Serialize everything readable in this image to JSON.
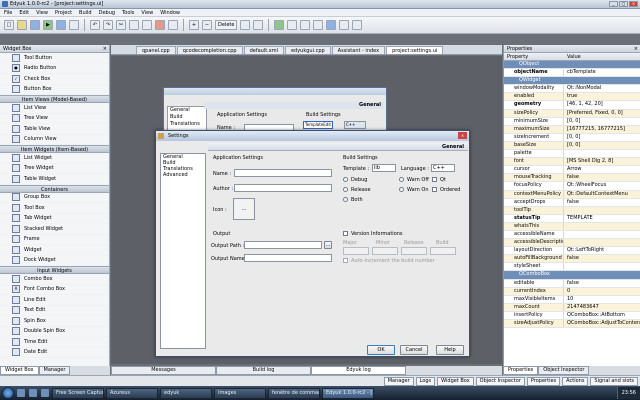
{
  "window": {
    "title": "Edyuk 1.0.0-rc2 - [project:settings.ui]"
  },
  "menu": [
    "File",
    "Edit",
    "View",
    "Project",
    "Build",
    "Debug",
    "Tools",
    "View",
    "Window"
  ],
  "toolbar": {
    "delete_label": "Delete"
  },
  "left_panel": {
    "title": "Widget Box",
    "groups": [
      {
        "items": [
          {
            "label": "Tool Button",
            "icon": "tool-button-icon"
          },
          {
            "label": "Radio Button",
            "icon": "radio-button-icon"
          },
          {
            "label": "Check Box",
            "icon": "check-box-icon"
          },
          {
            "label": "Button Box",
            "icon": "button-box-icon"
          }
        ]
      },
      {
        "title": "Item Views (Model-Based)",
        "items": [
          {
            "label": "List View"
          },
          {
            "label": "Tree View"
          },
          {
            "label": "Table View"
          },
          {
            "label": "Column View"
          }
        ]
      },
      {
        "title": "Item Widgets (Item-Based)",
        "items": [
          {
            "label": "List Widget"
          },
          {
            "label": "Tree Widget"
          },
          {
            "label": "Table Widget"
          }
        ]
      },
      {
        "title": "Containers",
        "items": [
          {
            "label": "Group Box"
          },
          {
            "label": "Tool Box"
          },
          {
            "label": "Tab Widget"
          },
          {
            "label": "Stacked Widget"
          },
          {
            "label": "Frame"
          },
          {
            "label": "Widget"
          },
          {
            "label": "Dock Widget"
          }
        ]
      },
      {
        "title": "Input Widgets",
        "items": [
          {
            "label": "Combo Box"
          },
          {
            "label": "Font Combo Box"
          },
          {
            "label": "Line Edit"
          },
          {
            "label": "Text Edit"
          },
          {
            "label": "Spin Box"
          },
          {
            "label": "Double Spin Box"
          },
          {
            "label": "Time Edit"
          },
          {
            "label": "Date Edit"
          }
        ]
      }
    ],
    "tabs": [
      "Widget Box",
      "Manager"
    ]
  },
  "doc_tabs": [
    "qpanel.cpp",
    "qcodecompletion.cpp",
    "default.xml",
    "edyukgui.cpp",
    "Assistant - index",
    "project:settings.ui"
  ],
  "bg_form": {
    "items": [
      "General",
      "Build",
      "Translations"
    ],
    "general": "General",
    "app_settings": "Application Settings",
    "name_label": "Name :",
    "build_settings": "Build Settings",
    "template_value": "TemplateEdit",
    "language_value": "C++"
  },
  "dialog": {
    "title": "Settings",
    "header": "General",
    "list": [
      "General",
      "Build",
      "Translations",
      "Advanced"
    ],
    "app_settings": "Application Settings",
    "name_label": "Name :",
    "author_label": "Author :",
    "icon_label": "Icon :",
    "icon_btn": "...",
    "output": "Output",
    "output_path": "Output Path :",
    "output_name": "Output Name :",
    "browse": "...",
    "build_settings": "Build Settings",
    "template_label": "Template :",
    "template_value": "lib",
    "language_label": "Language :",
    "language_value": "C++",
    "modes": [
      "Debug",
      "Release",
      "Both"
    ],
    "warn": [
      "Warn Off",
      "Warn On"
    ],
    "opts": [
      "Qt",
      "Ordered"
    ],
    "version_label": "Version Informations",
    "version_fields": [
      "Major",
      "Minor",
      "Release",
      "Build"
    ],
    "auto_inc": "Auto-increment the build number",
    "ok": "OK",
    "cancel": "Cancel",
    "help": "Help"
  },
  "properties": {
    "title": "Properties",
    "cols": [
      "Property",
      "Value"
    ],
    "rows": [
      {
        "s": "QObject"
      },
      {
        "k": "objectName",
        "v": "cbTemplate",
        "b": true
      },
      {
        "s": "QWidget"
      },
      {
        "k": "windowModality",
        "v": "Qt::NonModal"
      },
      {
        "k": "enabled",
        "v": "true"
      },
      {
        "k": "geometry",
        "v": "[46, 1, 42, 20]",
        "b": true
      },
      {
        "k": "sizePolicy",
        "v": "[Preferred, Fixed, 0, 0]"
      },
      {
        "k": "minimumSize",
        "v": "[0, 0]"
      },
      {
        "k": "maximumSize",
        "v": "[16777215, 16777215]"
      },
      {
        "k": "sizeIncrement",
        "v": "[0, 0]"
      },
      {
        "k": "baseSize",
        "v": "[0, 0]"
      },
      {
        "k": "palette",
        "v": ""
      },
      {
        "k": "font",
        "v": "[MS Shell Dlg 2, 8]"
      },
      {
        "k": "cursor",
        "v": "Arrow"
      },
      {
        "k": "mouseTracking",
        "v": "false"
      },
      {
        "k": "focusPolicy",
        "v": "Qt::WheelFocus"
      },
      {
        "k": "contextMenuPolicy",
        "v": "Qt::DefaultContextMenu"
      },
      {
        "k": "acceptDrops",
        "v": "false"
      },
      {
        "k": "toolTip",
        "v": ""
      },
      {
        "k": "statusTip",
        "v": "TEMPLATE",
        "b": true
      },
      {
        "k": "whatsThis",
        "v": ""
      },
      {
        "k": "accessibleName",
        "v": ""
      },
      {
        "k": "accessibleDescription",
        "v": ""
      },
      {
        "k": "layoutDirection",
        "v": "Qt::LeftToRight"
      },
      {
        "k": "autoFillBackground",
        "v": "false"
      },
      {
        "k": "styleSheet",
        "v": ""
      },
      {
        "s": "QComboBox"
      },
      {
        "k": "editable",
        "v": "false"
      },
      {
        "k": "currentIndex",
        "v": "0"
      },
      {
        "k": "maxVisibleItems",
        "v": "10"
      },
      {
        "k": "maxCount",
        "v": "2147483647"
      },
      {
        "k": "insertPolicy",
        "v": "QComboBox::AtBottom"
      },
      {
        "k": "sizeAdjustPolicy",
        "v": "QComboBox::AdjustToContentsOnFirstShow"
      }
    ],
    "tabs": [
      "Properties",
      "Object Inspector"
    ]
  },
  "bottom_tabs": [
    "Messages",
    "Build log",
    "Edyuk log"
  ],
  "status_buttons": [
    "Manager",
    "Logs",
    "Widget Box",
    "Object Inspector",
    "Properties",
    "Actions",
    "Signal and slots"
  ],
  "taskbar": {
    "items": [
      "Free Screen Capture...",
      "Azureus",
      "edyuk",
      "Images",
      "fenêtre de commandes",
      "Edyuk 1.0.0-rc2 - [..."
    ],
    "clock": "23:56"
  }
}
